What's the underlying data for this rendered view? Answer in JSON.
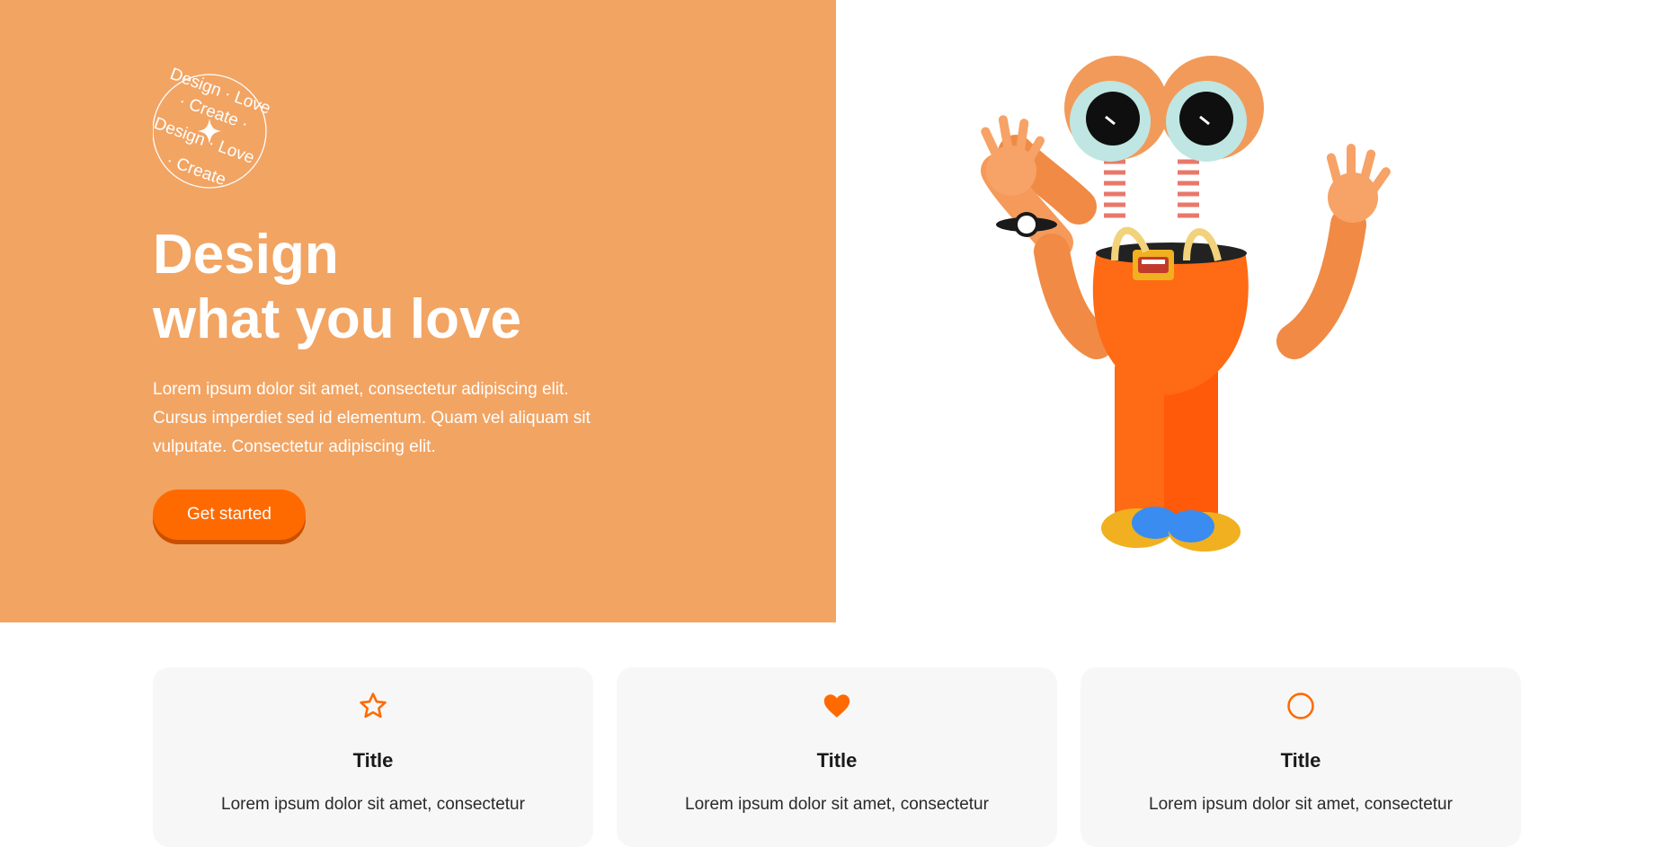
{
  "hero": {
    "badge_text": "Design · Love · Create · Design · Love · Create",
    "title_line1": "Design",
    "title_line2": "what you love",
    "description": "Lorem ipsum dolor sit amet, consectetur adipiscing elit. Cursus imperdiet sed id elementum. Quam vel aliquam sit vulputate. Consectetur adipiscing elit.",
    "cta_label": "Get started"
  },
  "colors": {
    "hero_background": "#f2a463",
    "accent": "#ff6a00",
    "card_background": "#f7f7f7"
  },
  "illustration": {
    "subject": "3D orange character with two eyes on springs, waving"
  },
  "cards": [
    {
      "icon": "star-outline-icon",
      "title": "Title",
      "text": "Lorem ipsum dolor sit amet, consectetur"
    },
    {
      "icon": "heart-icon",
      "title": "Title",
      "text": "Lorem ipsum dolor sit amet, consectetur"
    },
    {
      "icon": "circle-outline-icon",
      "title": "Title",
      "text": "Lorem ipsum dolor sit amet, consectetur"
    }
  ]
}
